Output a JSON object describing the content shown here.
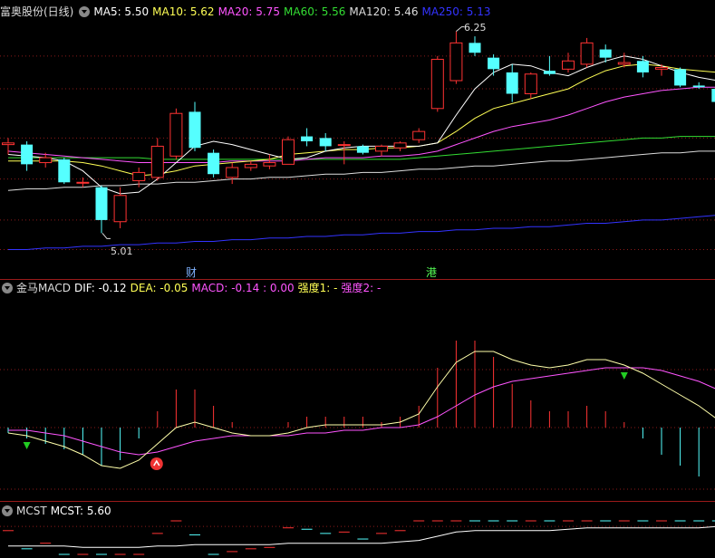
{
  "main": {
    "title": "富奥股份(日线)",
    "ma": [
      {
        "label": "MA5: 5.50",
        "color": "#ffffff"
      },
      {
        "label": "MA10: 5.62",
        "color": "#ffff55"
      },
      {
        "label": "MA20: 5.75",
        "color": "#ff55ff"
      },
      {
        "label": "MA60: 5.56",
        "color": "#33dd33"
      },
      {
        "label": "MA120: 5.46",
        "color": "#dddddd"
      },
      {
        "label": "MA250: 5.13",
        "color": "#3333ff"
      }
    ],
    "high_label": "6.25",
    "low_label": "5.01",
    "event_cai": "财",
    "event_gang": "港"
  },
  "macd": {
    "title": "金马MACD",
    "items": [
      {
        "label": "DIF: -0.12",
        "color": "#ffffff"
      },
      {
        "label": "DEA: -0.05",
        "color": "#ffff55"
      },
      {
        "label": "MACD: -0.14 : 0.00",
        "color": "#ff55ff"
      },
      {
        "label": "强度1: -",
        "color": "#ffff55"
      },
      {
        "label": "强度2: -",
        "color": "#ff55ff"
      }
    ]
  },
  "mcst": {
    "title": "MCST",
    "items": [
      {
        "label": "MCST: 5.60",
        "color": "#ffffff"
      }
    ]
  },
  "colors": {
    "up": "#ff3333",
    "down": "#55ffff",
    "grid": "#8b1a1a"
  },
  "chart_data": {
    "type": "candlestick",
    "candles": [
      {
        "o": 5.56,
        "h": 5.6,
        "l": 5.5,
        "c": 5.57
      },
      {
        "o": 5.56,
        "h": 5.58,
        "l": 5.4,
        "c": 5.44
      },
      {
        "o": 5.45,
        "h": 5.51,
        "l": 5.42,
        "c": 5.48
      },
      {
        "o": 5.47,
        "h": 5.48,
        "l": 5.32,
        "c": 5.33
      },
      {
        "o": 5.33,
        "h": 5.36,
        "l": 5.3,
        "c": 5.33
      },
      {
        "o": 5.3,
        "h": 5.31,
        "l": 5.02,
        "c": 5.1
      },
      {
        "o": 5.09,
        "h": 5.3,
        "l": 5.05,
        "c": 5.25
      },
      {
        "o": 5.34,
        "h": 5.42,
        "l": 5.3,
        "c": 5.39
      },
      {
        "o": 5.36,
        "h": 5.6,
        "l": 5.34,
        "c": 5.55
      },
      {
        "o": 5.49,
        "h": 5.78,
        "l": 5.47,
        "c": 5.75
      },
      {
        "o": 5.76,
        "h": 5.82,
        "l": 5.52,
        "c": 5.54
      },
      {
        "o": 5.51,
        "h": 5.53,
        "l": 5.36,
        "c": 5.38
      },
      {
        "o": 5.36,
        "h": 5.45,
        "l": 5.32,
        "c": 5.42
      },
      {
        "o": 5.42,
        "h": 5.46,
        "l": 5.4,
        "c": 5.44
      },
      {
        "o": 5.43,
        "h": 5.5,
        "l": 5.41,
        "c": 5.45
      },
      {
        "o": 5.44,
        "h": 5.61,
        "l": 5.44,
        "c": 5.59
      },
      {
        "o": 5.61,
        "h": 5.66,
        "l": 5.55,
        "c": 5.58
      },
      {
        "o": 5.6,
        "h": 5.63,
        "l": 5.52,
        "c": 5.55
      },
      {
        "o": 5.56,
        "h": 5.58,
        "l": 5.44,
        "c": 5.56
      },
      {
        "o": 5.55,
        "h": 5.56,
        "l": 5.5,
        "c": 5.51
      },
      {
        "o": 5.52,
        "h": 5.56,
        "l": 5.49,
        "c": 5.55
      },
      {
        "o": 5.54,
        "h": 5.58,
        "l": 5.52,
        "c": 5.57
      },
      {
        "o": 5.59,
        "h": 5.66,
        "l": 5.57,
        "c": 5.64
      },
      {
        "o": 5.78,
        "h": 6.1,
        "l": 5.76,
        "c": 6.08
      },
      {
        "o": 5.95,
        "h": 6.25,
        "l": 5.93,
        "c": 6.18
      },
      {
        "o": 6.18,
        "h": 6.22,
        "l": 6.1,
        "c": 6.12
      },
      {
        "o": 6.09,
        "h": 6.11,
        "l": 5.98,
        "c": 6.02
      },
      {
        "o": 6.0,
        "h": 6.05,
        "l": 5.82,
        "c": 5.87
      },
      {
        "o": 5.87,
        "h": 6.0,
        "l": 5.84,
        "c": 5.99
      },
      {
        "o": 6.01,
        "h": 6.1,
        "l": 5.98,
        "c": 5.99
      },
      {
        "o": 6.02,
        "h": 6.12,
        "l": 6.0,
        "c": 6.07
      },
      {
        "o": 6.05,
        "h": 6.21,
        "l": 6.03,
        "c": 6.18
      },
      {
        "o": 6.14,
        "h": 6.17,
        "l": 6.06,
        "c": 6.09
      },
      {
        "o": 6.05,
        "h": 6.12,
        "l": 6.03,
        "c": 6.06
      },
      {
        "o": 6.07,
        "h": 6.1,
        "l": 5.97,
        "c": 6.0
      },
      {
        "o": 6.02,
        "h": 6.05,
        "l": 5.98,
        "c": 6.03
      },
      {
        "o": 6.02,
        "h": 6.03,
        "l": 5.91,
        "c": 5.92
      },
      {
        "o": 5.92,
        "h": 5.94,
        "l": 5.9,
        "c": 5.91
      },
      {
        "o": 5.9,
        "h": 5.92,
        "l": 5.81,
        "c": 5.82
      }
    ],
    "ma5": [
      5.5,
      5.49,
      5.48,
      5.46,
      5.4,
      5.3,
      5.26,
      5.27,
      5.35,
      5.45,
      5.55,
      5.58,
      5.56,
      5.53,
      5.5,
      5.47,
      5.48,
      5.52,
      5.54,
      5.55,
      5.55,
      5.55,
      5.55,
      5.57,
      5.74,
      5.9,
      6.0,
      6.05,
      6.04,
      6.0,
      5.98,
      6.03,
      6.07,
      6.1,
      6.08,
      6.04,
      6.0,
      5.97,
      5.95
    ],
    "ma10": [
      5.46,
      5.46,
      5.46,
      5.46,
      5.45,
      5.43,
      5.4,
      5.37,
      5.38,
      5.4,
      5.43,
      5.44,
      5.45,
      5.46,
      5.47,
      5.5,
      5.51,
      5.52,
      5.53,
      5.53,
      5.54,
      5.54,
      5.55,
      5.57,
      5.64,
      5.72,
      5.78,
      5.81,
      5.84,
      5.87,
      5.9,
      5.96,
      6.01,
      6.04,
      6.05,
      6.04,
      6.02,
      6.01,
      6.0
    ],
    "ma20": [
      5.52,
      5.51,
      5.5,
      5.49,
      5.48,
      5.47,
      5.46,
      5.45,
      5.45,
      5.45,
      5.45,
      5.45,
      5.46,
      5.46,
      5.46,
      5.46,
      5.47,
      5.48,
      5.48,
      5.48,
      5.49,
      5.49,
      5.5,
      5.52,
      5.56,
      5.6,
      5.64,
      5.67,
      5.69,
      5.71,
      5.74,
      5.78,
      5.82,
      5.85,
      5.87,
      5.89,
      5.9,
      5.91,
      5.91
    ],
    "ma60": [
      5.48,
      5.48,
      5.48,
      5.48,
      5.48,
      5.48,
      5.48,
      5.48,
      5.47,
      5.47,
      5.47,
      5.47,
      5.47,
      5.47,
      5.47,
      5.47,
      5.47,
      5.47,
      5.47,
      5.47,
      5.47,
      5.47,
      5.48,
      5.49,
      5.5,
      5.51,
      5.52,
      5.53,
      5.54,
      5.55,
      5.56,
      5.57,
      5.58,
      5.59,
      5.6,
      5.6,
      5.61,
      5.61,
      5.61
    ],
    "ma120": [
      5.28,
      5.29,
      5.29,
      5.3,
      5.3,
      5.31,
      5.31,
      5.32,
      5.32,
      5.33,
      5.33,
      5.34,
      5.35,
      5.35,
      5.36,
      5.36,
      5.37,
      5.38,
      5.38,
      5.39,
      5.39,
      5.4,
      5.41,
      5.41,
      5.42,
      5.43,
      5.43,
      5.44,
      5.45,
      5.46,
      5.46,
      5.47,
      5.48,
      5.49,
      5.5,
      5.51,
      5.51,
      5.52,
      5.52
    ],
    "ma250": [
      4.92,
      4.92,
      4.93,
      4.93,
      4.94,
      4.94,
      4.95,
      4.95,
      4.96,
      4.96,
      4.97,
      4.97,
      4.98,
      4.98,
      4.99,
      4.99,
      5.0,
      5.0,
      5.01,
      5.01,
      5.02,
      5.02,
      5.03,
      5.03,
      5.04,
      5.04,
      5.05,
      5.05,
      5.06,
      5.06,
      5.07,
      5.08,
      5.08,
      5.09,
      5.1,
      5.1,
      5.11,
      5.12,
      5.13
    ],
    "dif": [
      -0.02,
      -0.03,
      -0.05,
      -0.07,
      -0.1,
      -0.14,
      -0.15,
      -0.12,
      -0.06,
      0.0,
      0.02,
      0.0,
      -0.02,
      -0.03,
      -0.03,
      -0.02,
      0.0,
      0.01,
      0.01,
      0.01,
      0.01,
      0.02,
      0.05,
      0.15,
      0.24,
      0.28,
      0.28,
      0.25,
      0.23,
      0.22,
      0.23,
      0.25,
      0.25,
      0.23,
      0.2,
      0.16,
      0.12,
      0.08,
      0.03
    ],
    "dea": [
      -0.01,
      -0.01,
      -0.02,
      -0.03,
      -0.05,
      -0.07,
      -0.09,
      -0.1,
      -0.09,
      -0.07,
      -0.05,
      -0.04,
      -0.03,
      -0.03,
      -0.03,
      -0.03,
      -0.02,
      -0.02,
      -0.01,
      -0.01,
      0.0,
      0.0,
      0.01,
      0.04,
      0.08,
      0.12,
      0.15,
      0.17,
      0.18,
      0.19,
      0.2,
      0.21,
      0.22,
      0.22,
      0.22,
      0.21,
      0.19,
      0.17,
      0.14
    ],
    "macd_bar": [
      -0.02,
      -0.04,
      -0.06,
      -0.08,
      -0.1,
      -0.14,
      -0.12,
      -0.04,
      0.06,
      0.14,
      0.14,
      0.08,
      0.02,
      0.0,
      0.0,
      0.02,
      0.04,
      0.04,
      0.04,
      0.04,
      0.02,
      0.04,
      0.08,
      0.22,
      0.32,
      0.32,
      0.26,
      0.16,
      0.1,
      0.06,
      0.06,
      0.08,
      0.06,
      0.02,
      -0.04,
      -0.1,
      -0.14,
      -0.18,
      -0.22
    ],
    "mcst": [
      5.46,
      5.46,
      5.46,
      5.46,
      5.45,
      5.45,
      5.45,
      5.45,
      5.46,
      5.46,
      5.47,
      5.47,
      5.47,
      5.47,
      5.47,
      5.48,
      5.48,
      5.48,
      5.48,
      5.48,
      5.48,
      5.49,
      5.5,
      5.53,
      5.56,
      5.57,
      5.57,
      5.57,
      5.57,
      5.57,
      5.58,
      5.59,
      5.59,
      5.59,
      5.59,
      5.59,
      5.59,
      5.59,
      5.6
    ]
  }
}
